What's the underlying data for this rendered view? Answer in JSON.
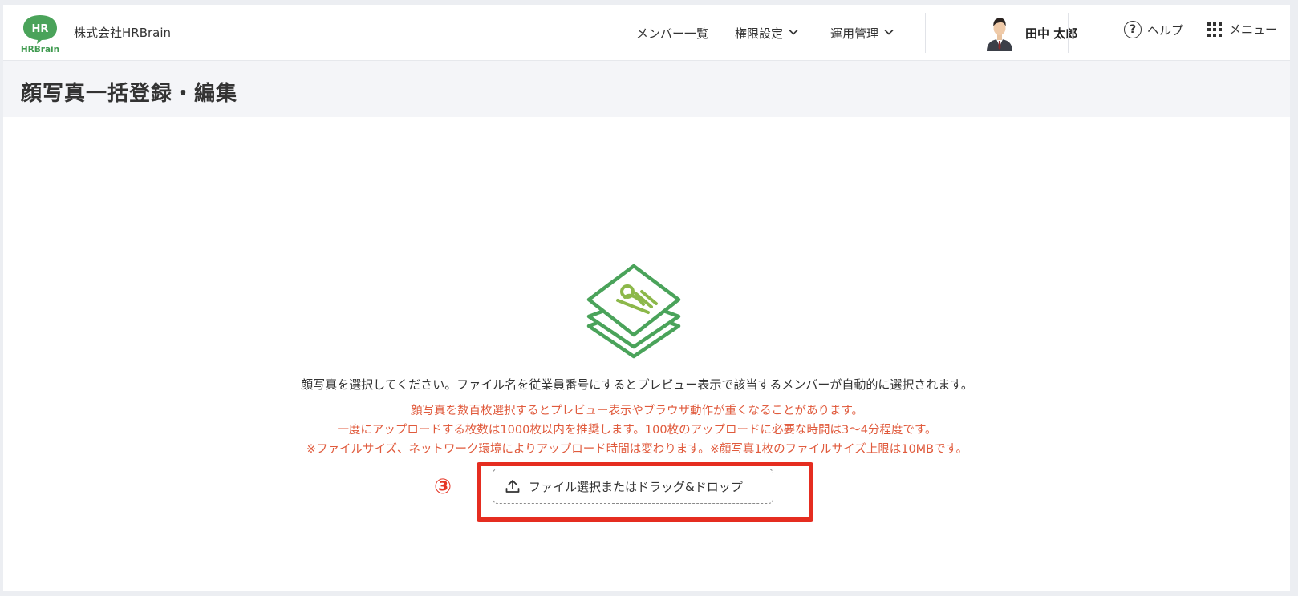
{
  "header": {
    "logo_text_top": "HR",
    "logo_text_bottom": "HRBrain",
    "company": "株式会社HRBrain",
    "nav": [
      {
        "label": "メンバー一覧"
      },
      {
        "label": "権限設定"
      },
      {
        "label": "運用管理"
      }
    ],
    "user_name": "田中 太郎",
    "help_label": "ヘルプ",
    "menu_label": "メニュー"
  },
  "page": {
    "title": "顔写真一括登録・編集"
  },
  "main": {
    "instruction": "顔写真を選択してください。ファイル名を従業員番号にするとプレビュー表示で該当するメンバーが自動的に選択されます。",
    "warnings": [
      "顔写真を数百枚選択するとプレビュー表示やブラウザ動作が重くなることがあります。",
      "一度にアップロードする枚数は1000枚以内を推奨します。100枚のアップロードに必要な時間は3〜4分程度です。",
      "※ファイルサイズ、ネットワーク環境によりアップロード時間は変わります。※顔写真1枚のファイルサイズ上限は10MBです。"
    ],
    "step_marker": "③",
    "upload_label": "ファイル選択またはドラッグ&ドロップ"
  },
  "colors": {
    "brand_green": "#4aa35a",
    "warning_red": "#e05a3c",
    "highlight_red": "#e52d20"
  }
}
